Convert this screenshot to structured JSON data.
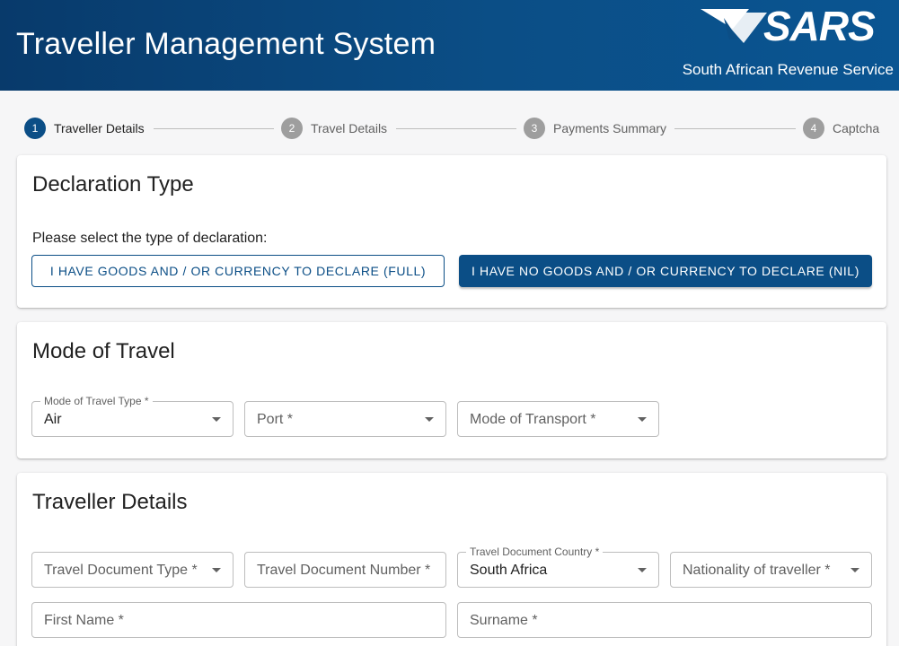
{
  "header": {
    "title": "Traveller Management System",
    "logo_text": "SARS",
    "org_name": "South African Revenue Service"
  },
  "stepper": {
    "steps": [
      {
        "number": "1",
        "label": "Traveller Details"
      },
      {
        "number": "2",
        "label": "Travel Details"
      },
      {
        "number": "3",
        "label": "Payments Summary"
      },
      {
        "number": "4",
        "label": "Captcha"
      }
    ],
    "active_step": 1
  },
  "declaration": {
    "title": "Declaration Type",
    "prompt": "Please select the type of declaration:",
    "full_button": "I HAVE GOODS AND / OR CURRENCY TO DECLARE (FULL)",
    "nil_button": "I HAVE NO GOODS AND / OR CURRENCY TO DECLARE (NIL)"
  },
  "mode_of_travel": {
    "title": "Mode of Travel",
    "type_label": "Mode of Travel Type *",
    "type_value": "Air",
    "port_placeholder": "Port *",
    "transport_placeholder": "Mode of Transport *"
  },
  "traveller_details": {
    "title": "Traveller Details",
    "doc_type_placeholder": "Travel Document Type *",
    "doc_number_placeholder": "Travel Document Number *",
    "doc_country_label": "Travel Document Country *",
    "doc_country_value": "South Africa",
    "nationality_placeholder": "Nationality of traveller *",
    "first_name_placeholder": "First Name *",
    "surname_placeholder": "Surname *"
  },
  "colors": {
    "primary": "#0b4e86",
    "header_dark": "#083a6b",
    "step_inactive": "#9e9e9e",
    "page_bg": "#f6f6f7"
  },
  "icons": {
    "dropdown": "chevron-down-icon",
    "logo": "sars-logo-icon"
  }
}
